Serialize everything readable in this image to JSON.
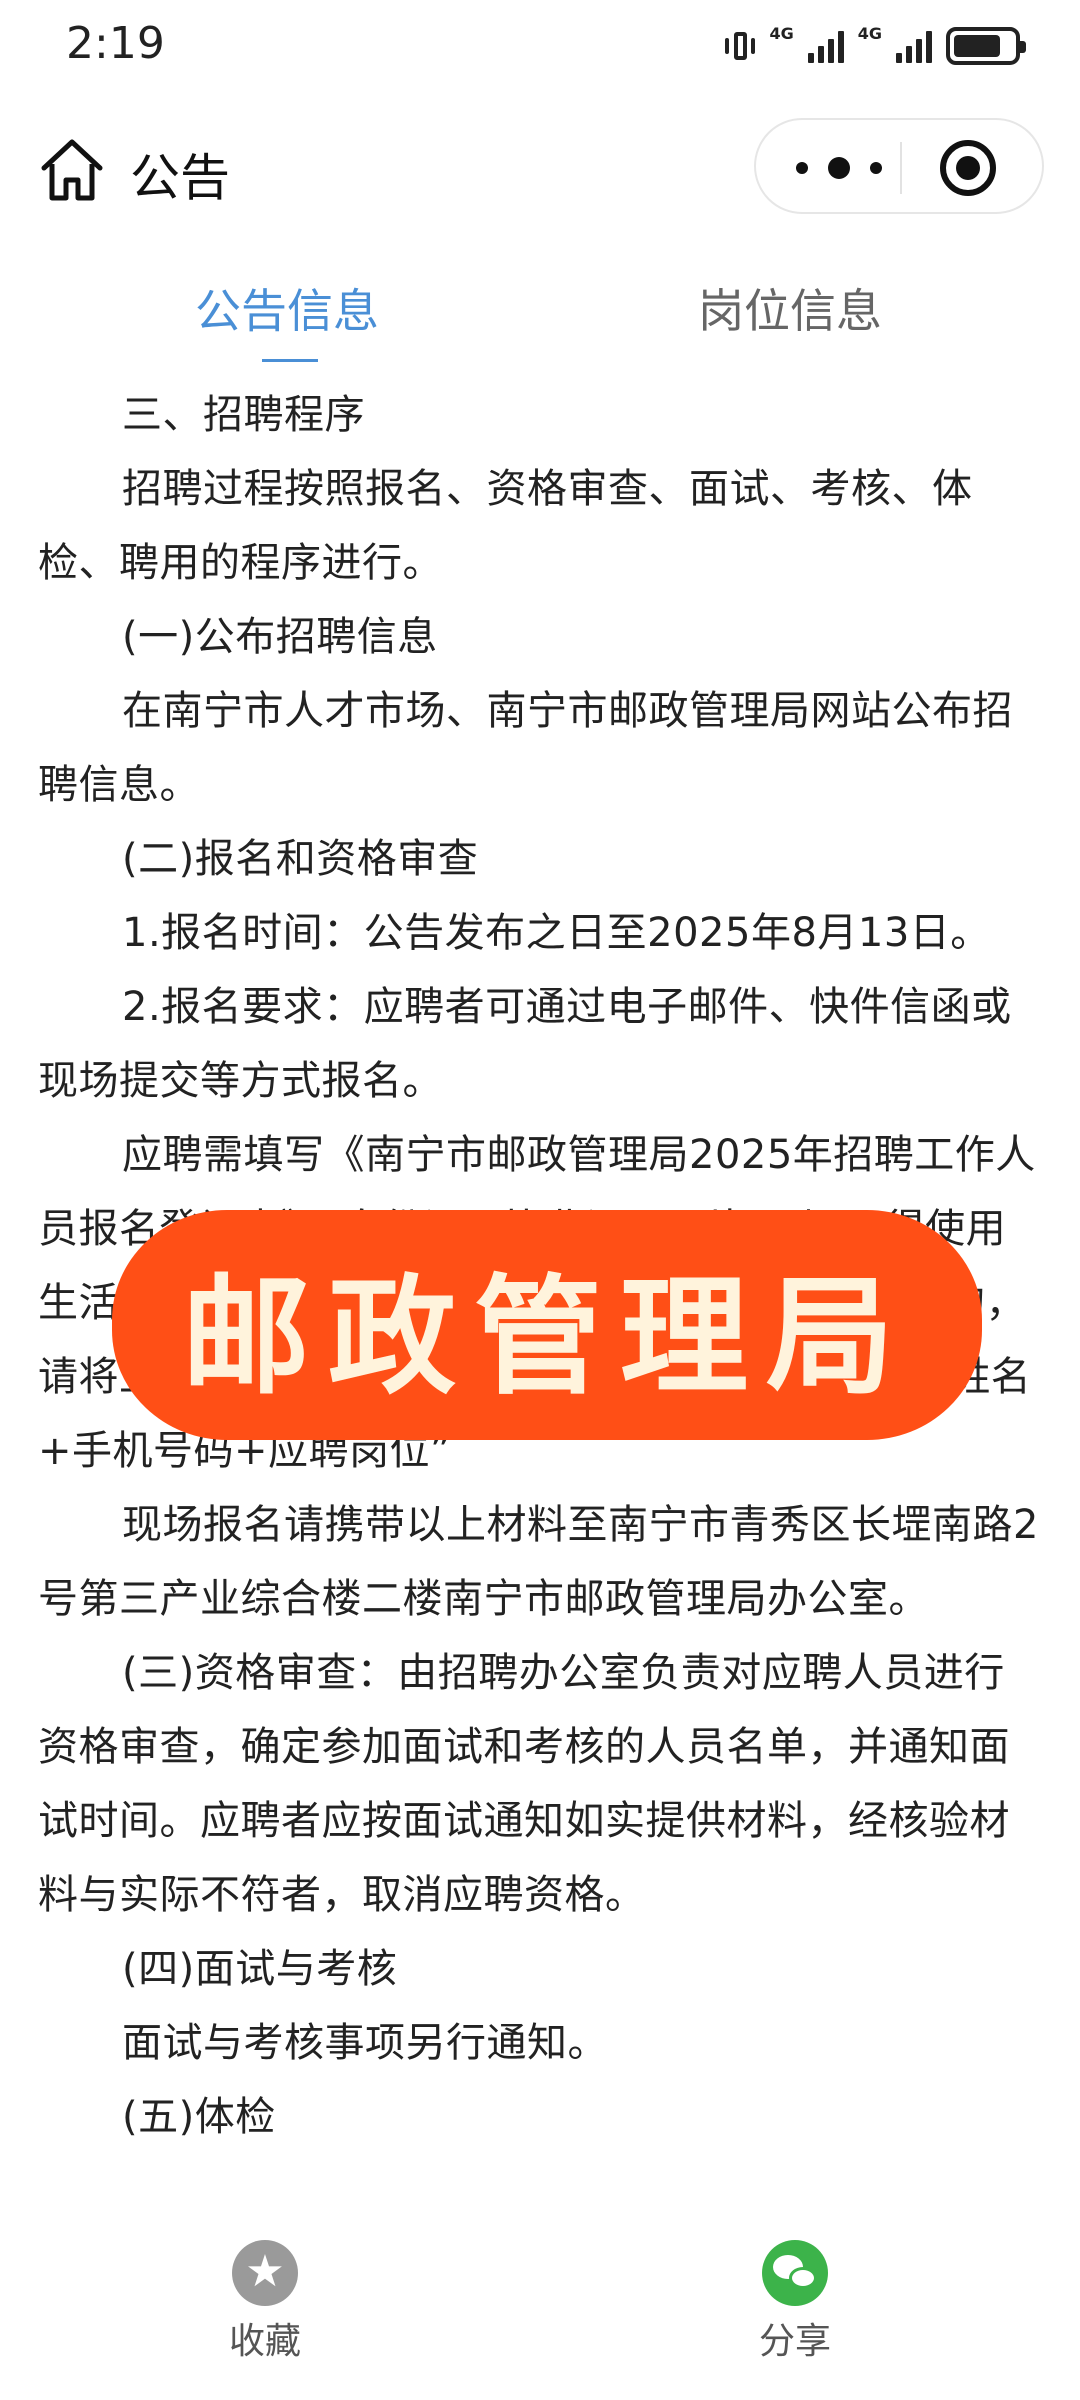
{
  "status_bar": {
    "time": "2:19",
    "network1": "4G",
    "network2": "4G",
    "battery_level": 0.8
  },
  "nav": {
    "title": "公告"
  },
  "tabs": [
    {
      "label": "公告信息",
      "active": true
    },
    {
      "label": "岗位信息",
      "active": false
    }
  ],
  "article": {
    "paragraphs": [
      "三、招聘程序",
      "招聘过程按照报名、资格审查、面试、考核、体检、聘用的程序进行。",
      "(一)公布招聘信息",
      "在南宁市人才市场、南宁市邮政管理局网站公布招聘信息。",
      "(二)报名和资格审查",
      "1.报名时间：公告发布之日至2025年8月13日。",
      "2.报名要求：应聘者可通过电子邮件、快件信函或现场提交等方式报名。",
      "应聘需填写《南宁市邮政管理局2025年招聘工作人员报名登记表》、身份证、毕业证、照片一张(不得使用生活照)等材料扫描件或复印件，通过电子邮件报名的，请将上述材料扫描件放入一个文件夹并统一命名为“姓名+手机号码+应聘岗位”",
      "现场报名请携带以上材料至南宁市青秀区长堽南路2号第三产业综合楼二楼南宁市邮政管理局办公室。",
      "(三)资格审查：由招聘办公室负责对应聘人员进行资格审查，确定参加面试和考核的人员名单，并通知面试时间。应聘者应按面试通知如实提供材料，经核验材料与实际不符者，取消应聘资格。",
      "(四)面试与考核",
      "面试与考核事项另行通知。",
      "(五)体检"
    ]
  },
  "watermark": {
    "text": "邮政管理局",
    "color": "#ff4f16"
  },
  "bottom_bar": {
    "favorite_label": "收藏",
    "share_label": "分享"
  },
  "colors": {
    "accent": "#4a8fd6",
    "wechat_green": "#3cb34a"
  }
}
